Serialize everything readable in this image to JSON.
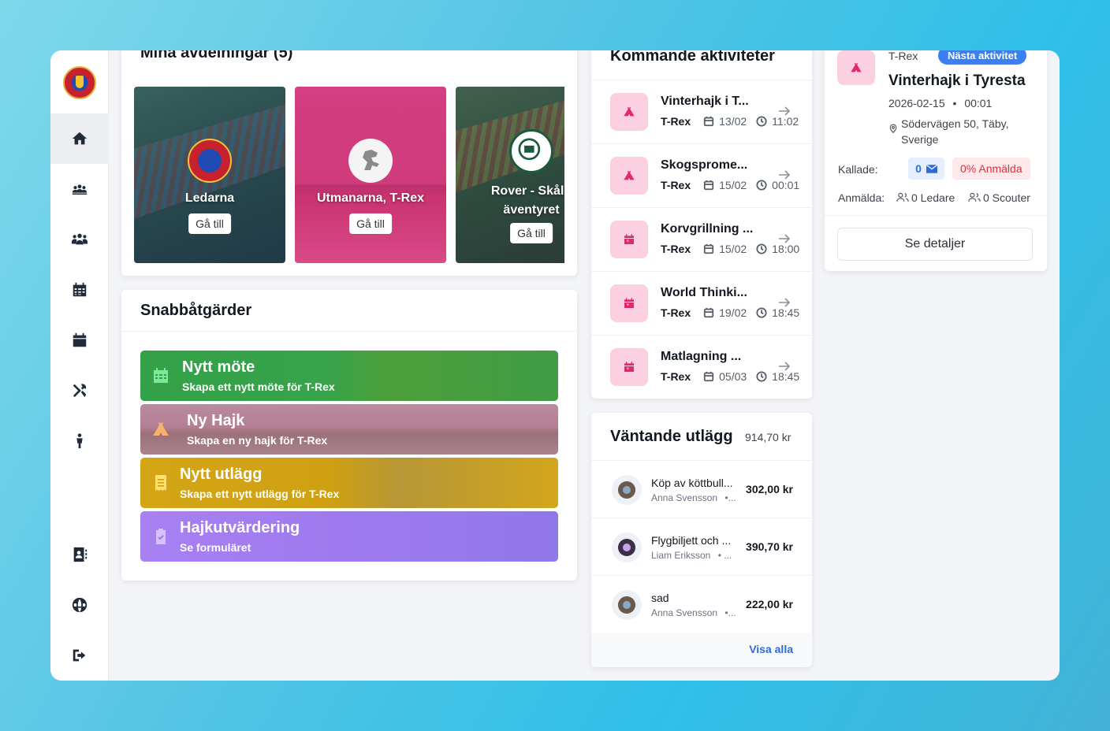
{
  "sidebar": {
    "logo": "scout-logo",
    "nav": [
      {
        "icon": "home-icon",
        "active": true
      },
      {
        "icon": "groups-icon"
      },
      {
        "icon": "users-icon"
      },
      {
        "icon": "calendar-grid-icon"
      },
      {
        "icon": "calendar-icon"
      },
      {
        "icon": "tools-icon"
      },
      {
        "icon": "person-icon"
      },
      {
        "icon": "contact-book-icon"
      },
      {
        "icon": "globe-icon"
      },
      {
        "icon": "logout-icon"
      }
    ]
  },
  "departments": {
    "title": "Mina avdelningar (5)",
    "items": [
      {
        "name": "Ledarna",
        "button": "Gå till",
        "color": "#1d4b5a"
      },
      {
        "name": "Utmanarna, T-Rex",
        "button": "Gå till",
        "color": "#d8357a"
      },
      {
        "name": "Rover - Skål för äventyret",
        "name_line1": "Rover - Skål f",
        "name_line2": "äventyret",
        "button": "Gå till",
        "color": "#3a4e3c"
      }
    ]
  },
  "quick_actions": {
    "title": "Snabbåtgärder",
    "items": [
      {
        "title": "Nytt möte",
        "subtitle": "Skapa ett nytt möte för T-Rex",
        "icon": "calendar-grid-icon",
        "color": "#3aa34b"
      },
      {
        "title": "Ny Hajk",
        "subtitle": "Skapa en ny hajk för T-Rex",
        "icon": "tent-icon",
        "color": "#b67e92"
      },
      {
        "title": "Nytt utlägg",
        "subtitle": "Skapa ett nytt utlägg för T-Rex",
        "icon": "receipt-icon",
        "color": "#d4a514"
      },
      {
        "title": "Hajkutvärdering",
        "subtitle": "Se formuläret",
        "icon": "clipboard-icon",
        "color": "#a07ef0"
      }
    ]
  },
  "activities": {
    "title": "Kommande aktiviteter",
    "items": [
      {
        "name": "Vinterhajk i T...",
        "unit": "T-Rex",
        "date": "13/02",
        "time": "11:02",
        "icon": "tent-icon"
      },
      {
        "name": "Skogsprome...",
        "unit": "T-Rex",
        "date": "15/02",
        "time": "00:01",
        "icon": "tent-icon"
      },
      {
        "name": "Korvgrillning ...",
        "unit": "T-Rex",
        "date": "15/02",
        "time": "18:00",
        "icon": "calendar-icon"
      },
      {
        "name": "World Thinki...",
        "unit": "T-Rex",
        "date": "19/02",
        "time": "18:45",
        "icon": "calendar-icon"
      },
      {
        "name": "Matlagning ...",
        "unit": "T-Rex",
        "date": "05/03",
        "time": "18:45",
        "icon": "calendar-icon"
      }
    ]
  },
  "next_activity": {
    "unit": "T-Rex",
    "badge": "Nästa aktivitet",
    "title": "Vinterhajk i Tyresta",
    "date": "2026-02-15",
    "separator": "•",
    "time": "00:01",
    "location_line1": "Södervägen 50, Täby,",
    "location_line2": "Sverige",
    "called_label": "Kallade:",
    "called_count": "0",
    "signed_pct": "0% Anmälda",
    "signed_label": "Anmälda:",
    "leaders": "0 Ledare",
    "scouts": "0 Scouter",
    "details_button": "Se detaljer"
  },
  "expenses": {
    "title": "Väntande utlägg",
    "total": "914,70 kr",
    "items": [
      {
        "title": "Köp av köttbull...",
        "person": "Anna Svensson",
        "more": "•...",
        "amount": "302,00 kr",
        "avatar_color": "#7d6b5c"
      },
      {
        "title": "Flygbiljett och ...",
        "person": "Liam Eriksson",
        "more": "•   ...",
        "amount": "390,70 kr",
        "avatar_color": "#4b3b5e"
      },
      {
        "title": "sad",
        "person": "Anna Svensson",
        "more": "•...",
        "amount": "222,00 kr",
        "avatar_color": "#7d6b5c"
      }
    ],
    "view_all": "Visa alla"
  }
}
